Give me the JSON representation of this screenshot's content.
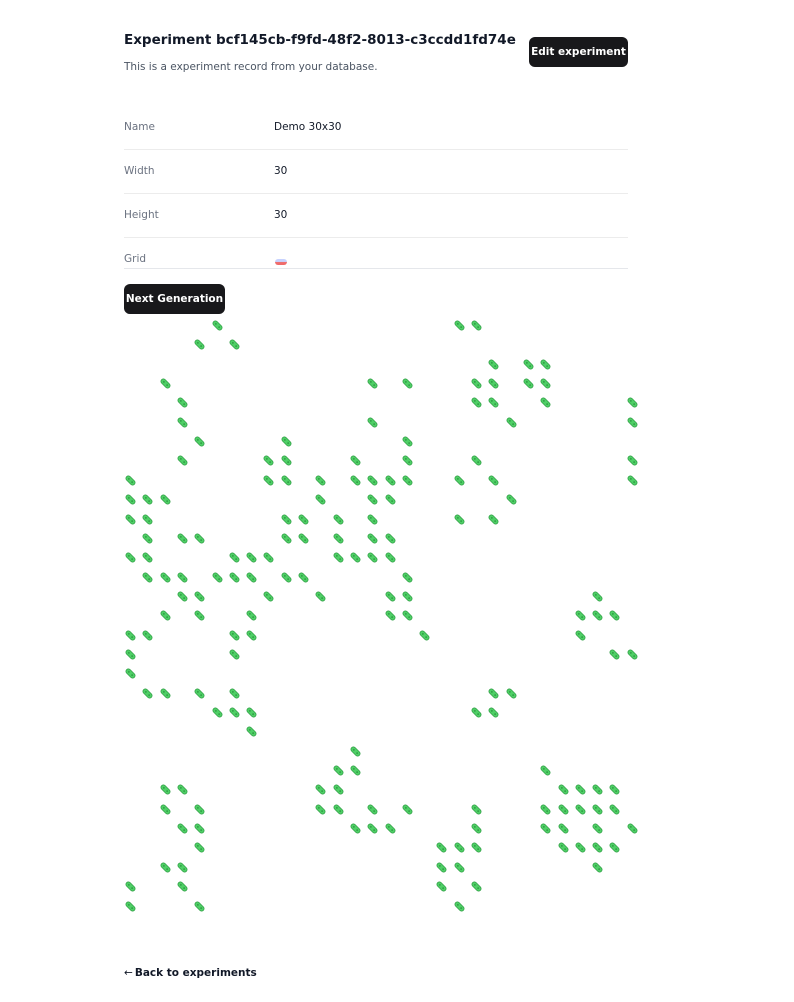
{
  "header": {
    "title": "Experiment bcf145cb-f9fd-48f2-8013-c3ccdd1fd74e",
    "subtitle": "This is a experiment record from your database.",
    "edit_label": "Edit experiment"
  },
  "details": {
    "name_label": "Name",
    "name_value": "Demo 30x30",
    "width_label": "Width",
    "width_value": "30",
    "height_label": "Height",
    "height_value": "30",
    "grid_label": "Grid"
  },
  "actions": {
    "next_generation_label": "Next Generation"
  },
  "board": {
    "cols": 30,
    "rows": 30,
    "cell_icon": "bacteria-icon",
    "cell_color": "#4fcf66",
    "alive_cells": [
      [
        0,
        5
      ],
      [
        0,
        19
      ],
      [
        0,
        20
      ],
      [
        1,
        4
      ],
      [
        1,
        6
      ],
      [
        2,
        21
      ],
      [
        2,
        23
      ],
      [
        2,
        24
      ],
      [
        3,
        2
      ],
      [
        3,
        14
      ],
      [
        3,
        16
      ],
      [
        3,
        20
      ],
      [
        3,
        21
      ],
      [
        3,
        23
      ],
      [
        3,
        24
      ],
      [
        4,
        3
      ],
      [
        4,
        20
      ],
      [
        4,
        21
      ],
      [
        4,
        24
      ],
      [
        4,
        29
      ],
      [
        5,
        3
      ],
      [
        5,
        14
      ],
      [
        5,
        22
      ],
      [
        5,
        29
      ],
      [
        6,
        4
      ],
      [
        6,
        9
      ],
      [
        6,
        16
      ],
      [
        7,
        3
      ],
      [
        7,
        8
      ],
      [
        7,
        9
      ],
      [
        7,
        13
      ],
      [
        7,
        16
      ],
      [
        7,
        20
      ],
      [
        7,
        29
      ],
      [
        8,
        0
      ],
      [
        8,
        8
      ],
      [
        8,
        9
      ],
      [
        8,
        11
      ],
      [
        8,
        13
      ],
      [
        8,
        14
      ],
      [
        8,
        15
      ],
      [
        8,
        16
      ],
      [
        8,
        19
      ],
      [
        8,
        21
      ],
      [
        8,
        29
      ],
      [
        9,
        0
      ],
      [
        9,
        1
      ],
      [
        9,
        2
      ],
      [
        9,
        11
      ],
      [
        9,
        14
      ],
      [
        9,
        15
      ],
      [
        9,
        22
      ],
      [
        10,
        0
      ],
      [
        10,
        1
      ],
      [
        10,
        9
      ],
      [
        10,
        10
      ],
      [
        10,
        12
      ],
      [
        10,
        14
      ],
      [
        10,
        19
      ],
      [
        10,
        21
      ],
      [
        11,
        1
      ],
      [
        11,
        3
      ],
      [
        11,
        4
      ],
      [
        11,
        9
      ],
      [
        11,
        10
      ],
      [
        11,
        12
      ],
      [
        11,
        14
      ],
      [
        11,
        15
      ],
      [
        12,
        0
      ],
      [
        12,
        1
      ],
      [
        12,
        6
      ],
      [
        12,
        7
      ],
      [
        12,
        8
      ],
      [
        12,
        12
      ],
      [
        12,
        13
      ],
      [
        12,
        14
      ],
      [
        12,
        15
      ],
      [
        13,
        1
      ],
      [
        13,
        2
      ],
      [
        13,
        3
      ],
      [
        13,
        5
      ],
      [
        13,
        6
      ],
      [
        13,
        7
      ],
      [
        13,
        9
      ],
      [
        13,
        10
      ],
      [
        13,
        16
      ],
      [
        14,
        3
      ],
      [
        14,
        4
      ],
      [
        14,
        8
      ],
      [
        14,
        11
      ],
      [
        14,
        15
      ],
      [
        14,
        16
      ],
      [
        14,
        27
      ],
      [
        15,
        2
      ],
      [
        15,
        4
      ],
      [
        15,
        7
      ],
      [
        15,
        15
      ],
      [
        15,
        16
      ],
      [
        15,
        26
      ],
      [
        15,
        27
      ],
      [
        15,
        28
      ],
      [
        16,
        0
      ],
      [
        16,
        1
      ],
      [
        16,
        6
      ],
      [
        16,
        7
      ],
      [
        16,
        17
      ],
      [
        16,
        26
      ],
      [
        17,
        0
      ],
      [
        17,
        6
      ],
      [
        17,
        28
      ],
      [
        17,
        29
      ],
      [
        18,
        0
      ],
      [
        19,
        1
      ],
      [
        19,
        2
      ],
      [
        19,
        4
      ],
      [
        19,
        6
      ],
      [
        19,
        21
      ],
      [
        19,
        22
      ],
      [
        20,
        5
      ],
      [
        20,
        6
      ],
      [
        20,
        7
      ],
      [
        20,
        20
      ],
      [
        20,
        21
      ],
      [
        21,
        7
      ],
      [
        22,
        13
      ],
      [
        23,
        12
      ],
      [
        23,
        13
      ],
      [
        23,
        24
      ],
      [
        24,
        2
      ],
      [
        24,
        3
      ],
      [
        24,
        11
      ],
      [
        24,
        12
      ],
      [
        24,
        25
      ],
      [
        24,
        26
      ],
      [
        24,
        27
      ],
      [
        24,
        28
      ],
      [
        25,
        2
      ],
      [
        25,
        4
      ],
      [
        25,
        11
      ],
      [
        25,
        12
      ],
      [
        25,
        14
      ],
      [
        25,
        16
      ],
      [
        25,
        20
      ],
      [
        25,
        24
      ],
      [
        25,
        25
      ],
      [
        25,
        26
      ],
      [
        25,
        27
      ],
      [
        25,
        28
      ],
      [
        26,
        3
      ],
      [
        26,
        4
      ],
      [
        26,
        13
      ],
      [
        26,
        14
      ],
      [
        26,
        15
      ],
      [
        26,
        20
      ],
      [
        26,
        24
      ],
      [
        26,
        25
      ],
      [
        26,
        27
      ],
      [
        26,
        29
      ],
      [
        27,
        4
      ],
      [
        27,
        18
      ],
      [
        27,
        19
      ],
      [
        27,
        20
      ],
      [
        27,
        25
      ],
      [
        27,
        26
      ],
      [
        27,
        27
      ],
      [
        27,
        28
      ],
      [
        28,
        2
      ],
      [
        28,
        3
      ],
      [
        28,
        18
      ],
      [
        28,
        19
      ],
      [
        28,
        27
      ],
      [
        29,
        0
      ],
      [
        29,
        3
      ],
      [
        29,
        18
      ],
      [
        29,
        20
      ],
      [
        30,
        0
      ],
      [
        30,
        4
      ],
      [
        30,
        19
      ]
    ]
  },
  "footer": {
    "back_arrow": "←",
    "back_label": "Back to experiments"
  }
}
